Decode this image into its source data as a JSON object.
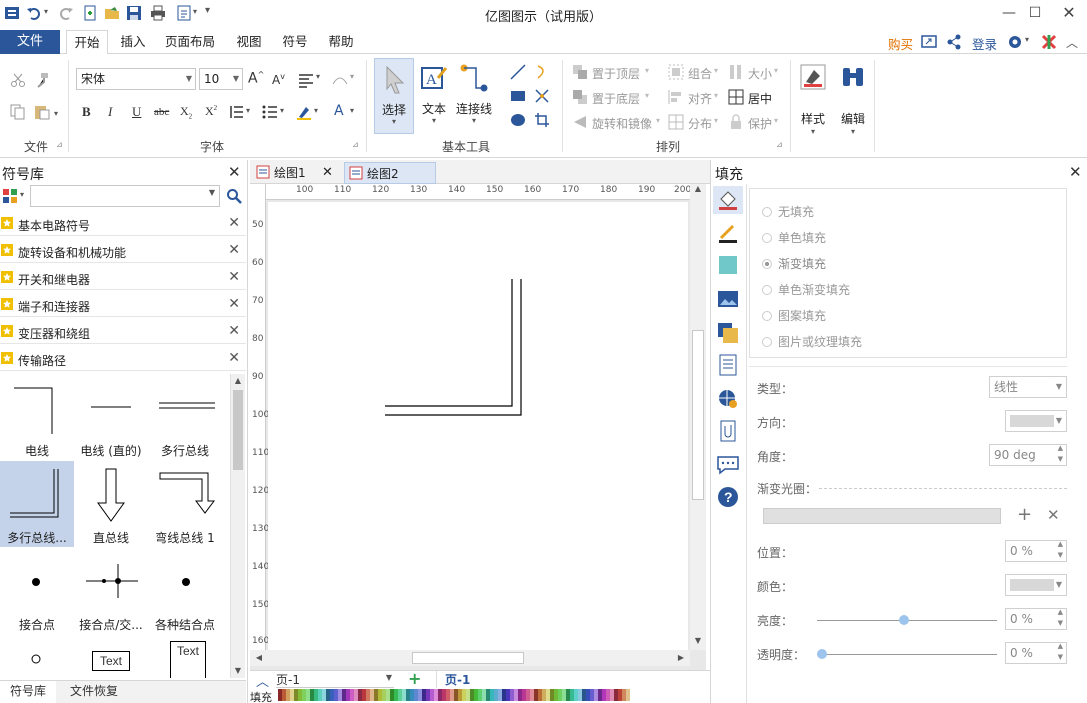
{
  "window": {
    "title": "亿图图示（试用版）"
  },
  "menu": {
    "file": "文件",
    "tabs": [
      "开始",
      "插入",
      "页面布局",
      "视图",
      "符号",
      "帮助"
    ],
    "right": {
      "buy": "购买",
      "login": "登录"
    }
  },
  "ribbon": {
    "file_group": "文件",
    "font_group": "字体",
    "font_name": "宋体",
    "font_size": "10",
    "basic_tools_group": "基本工具",
    "select": "选择",
    "text": "文本",
    "connector": "连接线",
    "arrange_group": "排列",
    "bring_front": "置于顶层",
    "send_back": "置于底层",
    "rotate_mirror": "旋转和镜像",
    "group": "组合",
    "align": "对齐",
    "distribute": "分布",
    "size": "大小",
    "center": "居中",
    "protect": "保护",
    "style": "样式",
    "edit": "编辑"
  },
  "left_panel": {
    "title": "符号库",
    "search_value": "",
    "libraries": [
      "基本电路符号",
      "旋转设备和机械功能",
      "开关和继电器",
      "端子和连接器",
      "变压器和绕组",
      "传输路径"
    ],
    "shapes": [
      {
        "label": "电线"
      },
      {
        "label": "电线 (直的)"
      },
      {
        "label": "多行总线"
      },
      {
        "label": "多行总线..."
      },
      {
        "label": "直总线"
      },
      {
        "label": "弯线总线 1"
      },
      {
        "label": "接合点"
      },
      {
        "label": "接合点/交..."
      },
      {
        "label": "各种结合点"
      },
      {
        "label": ""
      },
      {
        "label": "Text"
      },
      {
        "label": "Text"
      }
    ],
    "bottom_tabs": [
      "符号库",
      "文件恢复"
    ]
  },
  "doc_tabs": [
    "绘图1",
    "绘图2"
  ],
  "ruler": {
    "h": [
      "100",
      "110",
      "120",
      "130",
      "140",
      "150",
      "160",
      "170",
      "180",
      "190",
      "200"
    ],
    "v": [
      "50",
      "60",
      "70",
      "80",
      "90",
      "100",
      "110",
      "120",
      "130",
      "140",
      "150",
      "160"
    ]
  },
  "page_bar": {
    "page_select": "页-1",
    "page_tab": "页-1"
  },
  "fill_bar_label": "填充",
  "right_panel": {
    "title": "填充",
    "options": [
      "无填充",
      "单色填充",
      "渐变填充",
      "单色渐变填充",
      "图案填充",
      "图片或纹理填充"
    ],
    "selected_option": "渐变填充",
    "type_label": "类型：",
    "type_value": "线性",
    "direction_label": "方向：",
    "angle_label": "角度：",
    "angle_value": "90 deg",
    "gradient_label": "渐变光圈：",
    "position_label": "位置：",
    "position_value": "0 %",
    "color_label": "颜色：",
    "brightness_label": "亮度：",
    "brightness_value": "0 %",
    "transparency_label": "透明度：",
    "transparency_value": "0 %"
  },
  "colors": {
    "accent": "#2b579a",
    "buy": "#e07000",
    "selected_cell": "#c5d3ea",
    "tab_active": "#dce6f4"
  }
}
